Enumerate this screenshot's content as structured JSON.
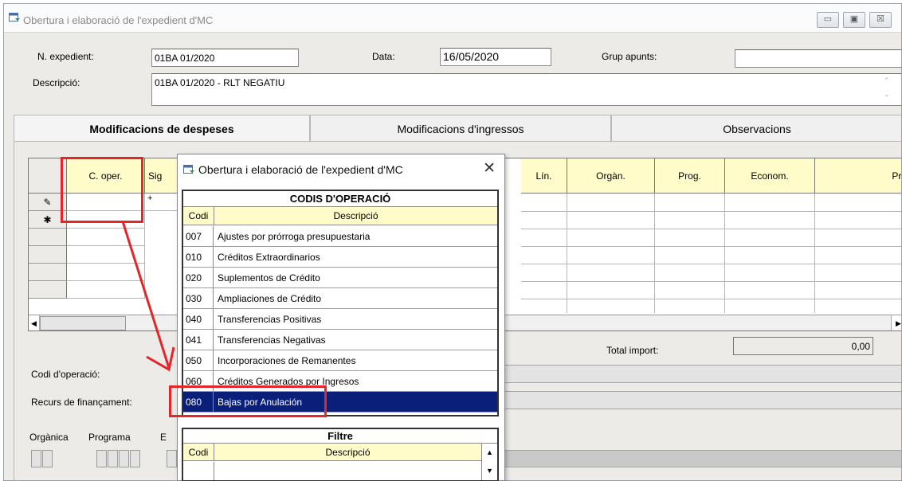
{
  "window": {
    "title": "Obertura i elaboració de l'expedient d'MC",
    "min_label": "▭",
    "max_label": "▣",
    "close_label": "☒"
  },
  "header": {
    "n_expedient_label": "N. expedient:",
    "n_expedient_value": "01BA 01/2020",
    "data_label": "Data:",
    "data_value": "16/05/2020",
    "grup_apunts_label": "Grup apunts:",
    "grup_apunts_value": "",
    "descripcio_label": "Descripció:",
    "descripcio_value": "01BA 01/2020 - RLT NEGATIU"
  },
  "tabs": [
    {
      "label": "Modificacions de despeses"
    },
    {
      "label": "Modificacions d'ingressos"
    },
    {
      "label": "Observacions"
    }
  ],
  "grid": {
    "columns": [
      "C. oper.",
      "Sig",
      "Lín.",
      "Orgàn.",
      "Prog.",
      "Econom.",
      "Pro"
    ],
    "row_markers": [
      "✎",
      "✱"
    ],
    "cell_plus": "+"
  },
  "totals": {
    "label": "Total import:",
    "value": "0,00"
  },
  "bottom": {
    "codi_operacio_label": "Codi d'operació:",
    "recurs_label": "Recurs de finançament:",
    "organica_label": "Orgànica",
    "programa_label": "Programa",
    "economica_label": "E"
  },
  "popup": {
    "title": "Obertura i elaboració de l'expedient d'MC",
    "close": "✕",
    "table_title": "CODIS D'OPERACIÓ",
    "col_codi": "Codi",
    "col_descripcio": "Descripció",
    "rows": [
      {
        "codi": "007",
        "desc": "Ajustes por prórroga presupuestaria"
      },
      {
        "codi": "010",
        "desc": "Créditos Extraordinarios"
      },
      {
        "codi": "020",
        "desc": "Suplementos de Crédito"
      },
      {
        "codi": "030",
        "desc": "Ampliaciones de Crédito"
      },
      {
        "codi": "040",
        "desc": "Transferencias Positivas"
      },
      {
        "codi": "041",
        "desc": "Transferencias Negativas"
      },
      {
        "codi": "050",
        "desc": "Incorporaciones de Remanentes"
      },
      {
        "codi": "060",
        "desc": "Créditos Generados por Ingresos"
      },
      {
        "codi": "080",
        "desc": "Bajas por Anulación"
      }
    ],
    "selected_index": 8,
    "filter_title": "Filtre",
    "filter_col_codi": "Codi",
    "filter_col_descripcio": "Descripció"
  },
  "colors": {
    "highlight": "#e2262a",
    "selection": "#0a1f7a",
    "header_yellow": "#fffcc9"
  }
}
